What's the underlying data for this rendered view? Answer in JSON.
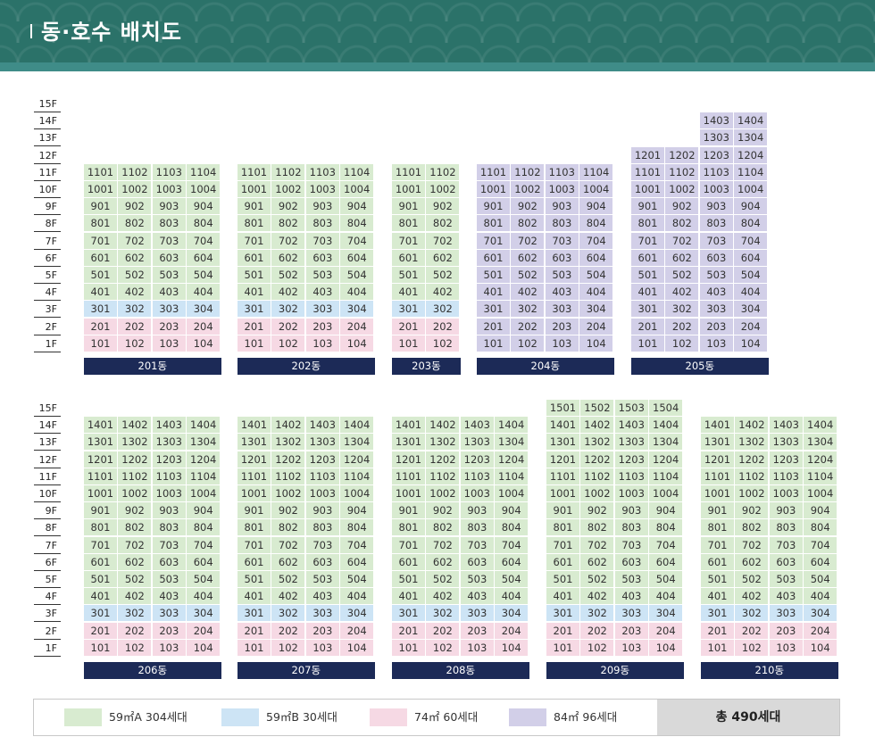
{
  "header": {
    "title": "동·호수 배치도"
  },
  "floors": [
    "15F",
    "14F",
    "13F",
    "12F",
    "11F",
    "10F",
    "9F",
    "8F",
    "7F",
    "6F",
    "5F",
    "4F",
    "3F",
    "2F",
    "1F"
  ],
  "colors": {
    "A": "#d8ebd0",
    "B": "#cde4f5",
    "C": "#f6d9e4",
    "D": "#d2cfe8"
  },
  "rows": [
    {
      "buildings": [
        {
          "name": "201동",
          "cols": 4,
          "topFloor": 11,
          "type": "A"
        },
        {
          "name": "202동",
          "cols": 4,
          "topFloor": 11,
          "type": "A"
        },
        {
          "name": "203동",
          "cols": 2,
          "topFloor": 11,
          "type": "A"
        },
        {
          "name": "204동",
          "cols": 4,
          "topFloor": 11,
          "type": "D"
        },
        {
          "name": "205동",
          "cols": 4,
          "topFloor": 12,
          "type": "D",
          "extra": {
            "floors": [
              14,
              13
            ],
            "cols": [
              3,
              4
            ]
          }
        }
      ]
    },
    {
      "buildings": [
        {
          "name": "206동",
          "cols": 4,
          "topFloor": 14,
          "type": "A"
        },
        {
          "name": "207동",
          "cols": 4,
          "topFloor": 14,
          "type": "A"
        },
        {
          "name": "208동",
          "cols": 4,
          "topFloor": 14,
          "type": "A"
        },
        {
          "name": "209동",
          "cols": 4,
          "topFloor": 15,
          "type": "A"
        },
        {
          "name": "210동",
          "cols": 4,
          "topFloor": 14,
          "type": "A"
        }
      ]
    }
  ],
  "legend": {
    "items": [
      {
        "type": "A",
        "label": "59㎡A  304세대"
      },
      {
        "type": "B",
        "label": "59㎡B  30세대"
      },
      {
        "type": "C",
        "label": "74㎡  60세대"
      },
      {
        "type": "D",
        "label": "84㎡  96세대"
      }
    ],
    "total": "총 490세대"
  }
}
